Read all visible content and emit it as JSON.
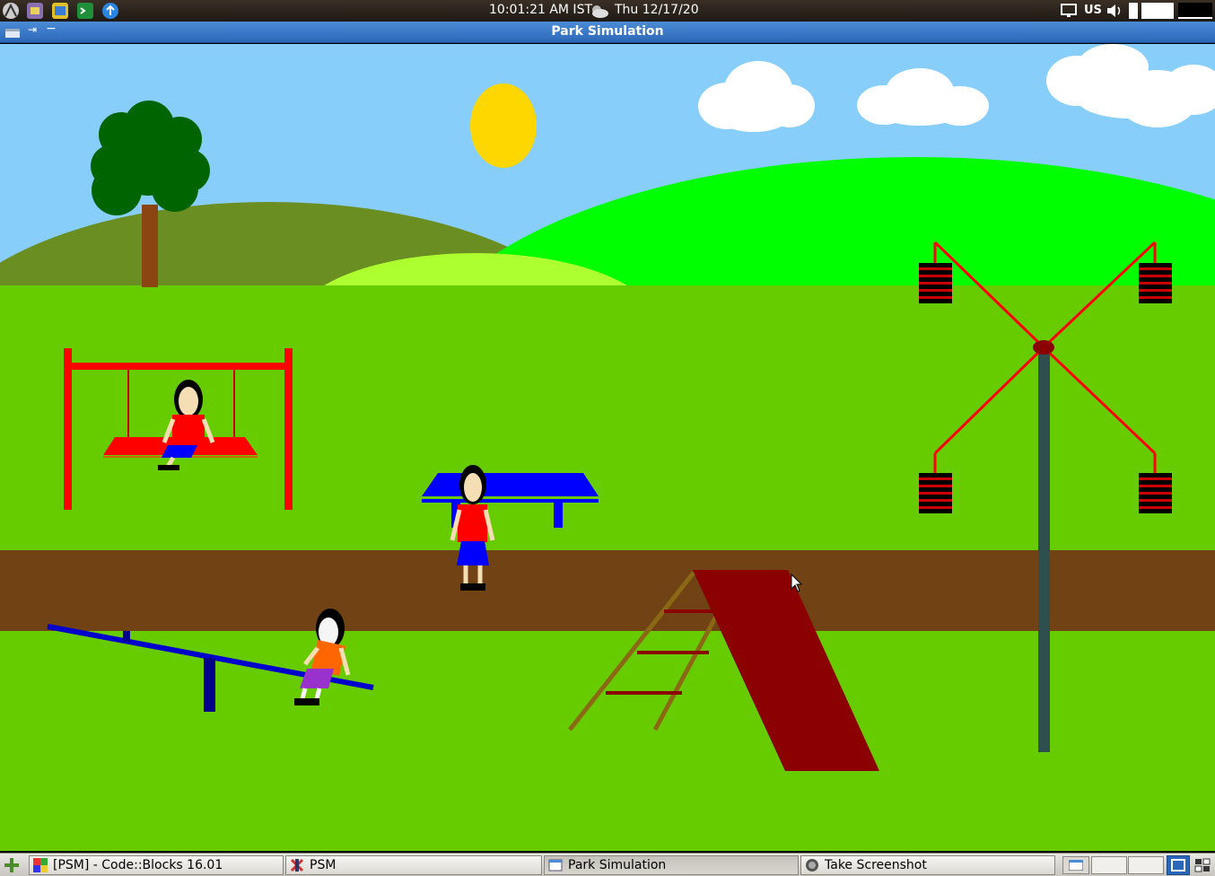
{
  "topbar": {
    "time": "10:01:21 AM IST",
    "date": "Thu 12/17/20",
    "keyboard": "US",
    "icons": [
      "app-menu-icon",
      "file-manager-icon",
      "browser-icon",
      "terminal-icon",
      "update-icon"
    ]
  },
  "window": {
    "title": "Park Simulation"
  },
  "taskbar": {
    "tasks": [
      {
        "label": "[PSM] - Code::Blocks 16.01",
        "icon": "codeblocks-icon"
      },
      {
        "label": "PSM",
        "icon": "xterm-icon"
      },
      {
        "label": "Park Simulation",
        "icon": "window-icon"
      },
      {
        "label": "Take Screenshot",
        "icon": "camera-icon"
      }
    ]
  },
  "colors": {
    "sky": "#87cefa",
    "grass": "#66cc00",
    "path": "#704214",
    "hill_dark": "#6b8e23",
    "hill_bright": "#00ff00",
    "hill_light": "#adff2f",
    "sun": "#ffd700",
    "swing": "#ff0000",
    "bench": "#0000ff",
    "slide": "#8b0000",
    "ladder": "#8b6914",
    "seesaw": "#00008b",
    "wheel_pole": "#2f4f4f"
  }
}
